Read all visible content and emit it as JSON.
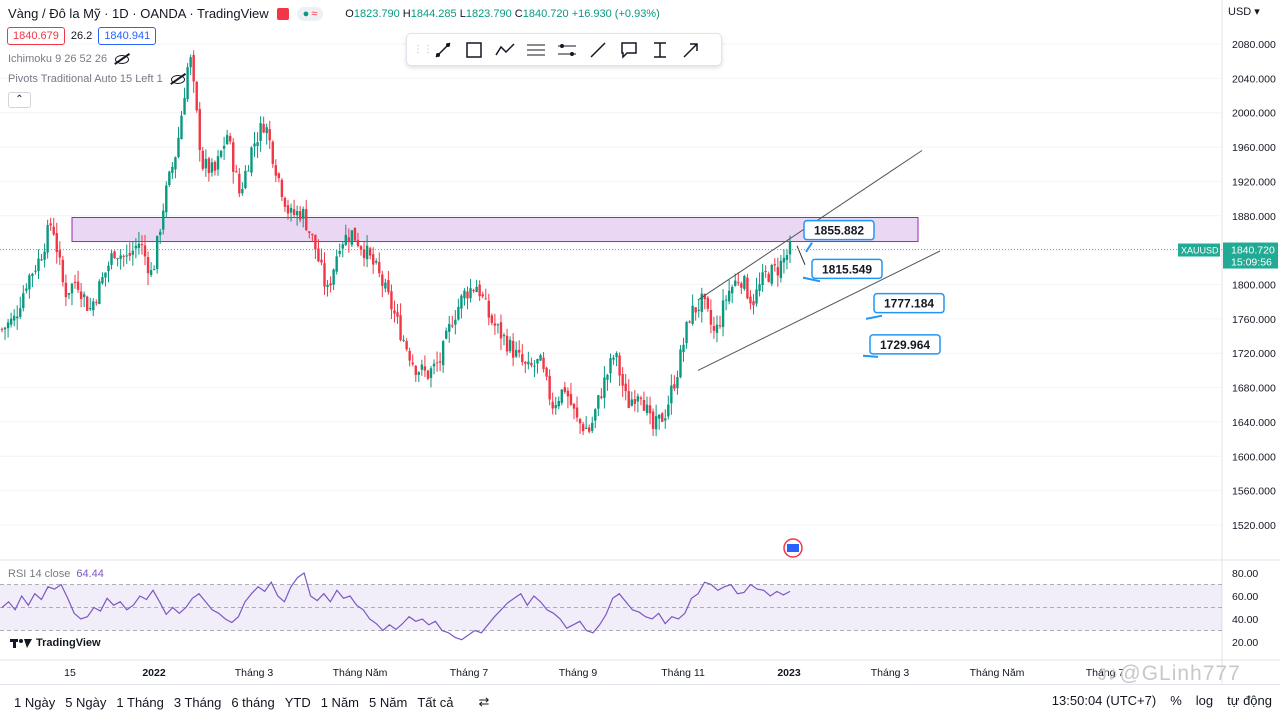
{
  "header": {
    "title": "Vàng / Đô la Mỹ · 1D · OANDA · TradingView",
    "ohlc": {
      "o_label": "O",
      "o": "1823.790",
      "h_label": "H",
      "h": "1844.285",
      "l_label": "L",
      "l": "1823.790",
      "c_label": "C",
      "c": "1840.720",
      "change": "+16.930 (+0.93%)"
    },
    "sell": "1840.679",
    "spread": "26.2",
    "buy": "1840.941",
    "indicator1": "Ichimoku 9 26 52 26",
    "indicator2": "Pivots Traditional Auto 15 Left 1",
    "currency": "USD"
  },
  "toolbar": {
    "tools": [
      "trend-line-icon",
      "rectangle-icon",
      "path-icon",
      "fib-channel-icon",
      "pitchfork-icon",
      "ray-icon",
      "callout-icon",
      "date-range-icon",
      "arrow-icon"
    ]
  },
  "colors": {
    "up": "#089981",
    "down": "#f23645",
    "zone": "#e1c9ef",
    "zone_border": "#9c27b0",
    "rsi": "#7e57c2",
    "callout": "#2196f3",
    "price_tag": "#22ab94"
  },
  "chart_data": [
    {
      "type": "candlestick",
      "symbol": "XAUUSD",
      "last_price": "1840.720",
      "countdown": "15:09:56",
      "ylim": [
        1480,
        2100
      ],
      "y_ticks": [
        "2080.000",
        "2040.000",
        "2000.000",
        "1960.000",
        "1920.000",
        "1880.000",
        "1840.000",
        "1800.000",
        "1760.000",
        "1720.000",
        "1680.000",
        "1640.000",
        "1600.000",
        "1560.000",
        "1520.000"
      ],
      "x_ticks": [
        "15",
        "2022",
        "Tháng 3",
        "Tháng Năm",
        "Tháng 7",
        "Tháng 9",
        "Tháng 11",
        "2023",
        "Tháng 3",
        "Tháng Năm",
        "Tháng 7"
      ],
      "path_key_prices": [
        1748,
        1760,
        1805,
        1830,
        1875,
        1790,
        1805,
        1770,
        1805,
        1840,
        1830,
        1850,
        1810,
        1900,
        1960,
        2070,
        1940,
        1930,
        1975,
        1905,
        1960,
        1990,
        1930,
        1880,
        1885,
        1845,
        1790,
        1850,
        1860,
        1840,
        1815,
        1780,
        1740,
        1705,
        1695,
        1710,
        1760,
        1790,
        1800,
        1760,
        1740,
        1720,
        1700,
        1710,
        1660,
        1680,
        1640,
        1630,
        1680,
        1720,
        1660,
        1680,
        1630,
        1650,
        1700,
        1765,
        1780,
        1740,
        1790,
        1810,
        1780,
        1810,
        1818,
        1840
      ],
      "resistance_zone": [
        1850,
        1878
      ],
      "wedge": {
        "upper": [
          [
            1782,
            1769
          ],
          [
            1956,
            1971
          ]
        ],
        "lower": [
          [
            1700,
            1701
          ],
          [
            1839,
            1974
          ]
        ]
      },
      "callouts": [
        "1855.882",
        "1815.549",
        "1777.184",
        "1729.964"
      ]
    },
    {
      "type": "line",
      "name": "RSI 14 close",
      "last_value": "64.44",
      "ylim": [
        20,
        85
      ],
      "y_ticks": [
        "80.00",
        "60.00",
        "40.00",
        "20.00"
      ],
      "levels": [
        70,
        50,
        30
      ],
      "values": [
        50,
        55,
        48,
        60,
        52,
        62,
        57,
        68,
        66,
        70,
        58,
        45,
        40,
        42,
        50,
        47,
        58,
        52,
        55,
        48,
        52,
        60,
        57,
        65,
        55,
        44,
        50,
        45,
        50,
        58,
        62,
        55,
        48,
        45,
        40,
        37,
        42,
        55,
        62,
        68,
        64,
        72,
        60,
        55,
        68,
        76,
        80,
        60,
        56,
        62,
        55,
        65,
        58,
        60,
        52,
        48,
        40,
        36,
        30,
        35,
        31,
        36,
        42,
        38,
        40,
        35,
        38,
        30,
        28,
        24,
        22,
        26,
        30,
        28,
        35,
        42,
        48,
        54,
        58,
        62,
        52,
        60,
        55,
        48,
        45,
        40,
        32,
        35,
        38,
        30,
        28,
        35,
        44,
        58,
        62,
        55,
        48,
        46,
        42,
        40,
        45,
        36,
        42,
        40,
        45,
        58,
        62,
        72,
        70,
        65,
        68,
        70,
        62,
        63,
        70,
        66,
        65,
        60,
        64,
        61,
        64
      ]
    }
  ],
  "bottom": {
    "ranges": [
      "1 Ngày",
      "5 Ngày",
      "1 Tháng",
      "3 Tháng",
      "6 tháng",
      "YTD",
      "1 Năm",
      "5 Năm",
      "Tất cả"
    ],
    "time": "13:50:04 (UTC+7)",
    "percent": "%",
    "log": "log",
    "auto": "tự động"
  },
  "brand": "TradingView",
  "watermark": "ᴊ♪@GLinh777"
}
